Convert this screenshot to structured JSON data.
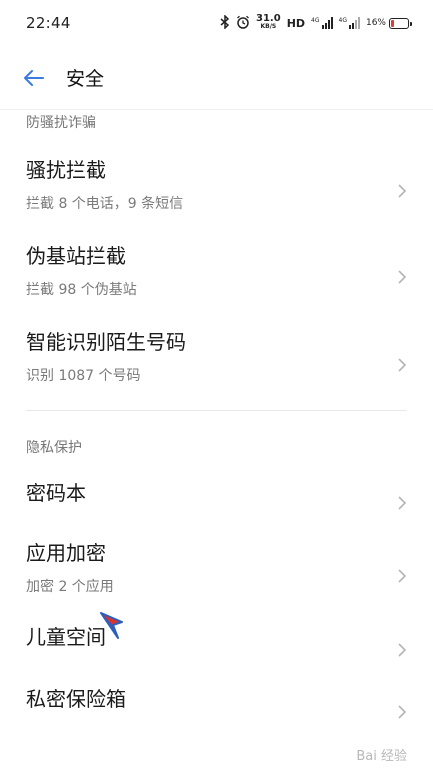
{
  "status_bar": {
    "time": "22:44",
    "speed_value": "31.0",
    "speed_unit": "KB/S",
    "hd": "HD",
    "signal1_label": "4G",
    "signal2_label": "4G",
    "battery_text": "16%",
    "battery_level": 0.16,
    "battery_color": "#e53935",
    "icons": [
      "bluetooth-icon",
      "alarm-icon",
      "signal-icon",
      "battery-icon"
    ]
  },
  "header": {
    "title": "安全",
    "back_icon": "back-arrow-icon",
    "accent": "#3a7bdc"
  },
  "sections": [
    {
      "header": "防骚扰诈骗",
      "items": [
        {
          "title": "骚扰拦截",
          "subtitle": "拦截 8 个电话，9 条短信"
        },
        {
          "title": "伪基站拦截",
          "subtitle": "拦截 98 个伪基站"
        },
        {
          "title": "智能识别陌生号码",
          "subtitle": "识别 1087 个号码"
        }
      ]
    },
    {
      "header": "隐私保护",
      "items": [
        {
          "title": "密码本",
          "subtitle": ""
        },
        {
          "title": "应用加密",
          "subtitle": "加密 2 个应用"
        },
        {
          "title": "儿童空间",
          "subtitle": ""
        },
        {
          "title": "私密保险箱",
          "subtitle": ""
        }
      ]
    }
  ],
  "watermark": {
    "text": "Bai 经验"
  }
}
